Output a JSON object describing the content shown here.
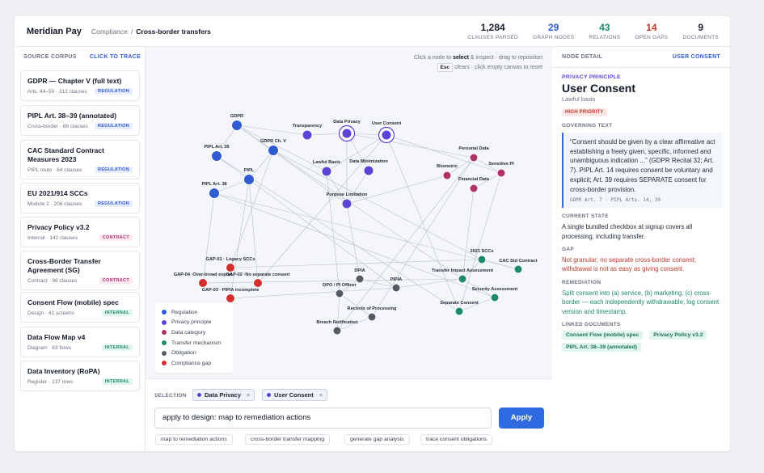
{
  "header": {
    "brand": "Meridian Pay",
    "breadcrumb_root": "Compliance",
    "breadcrumb_sep": "/",
    "breadcrumb_current": "Cross-border transfers",
    "stats": [
      {
        "value": "1,284",
        "label": "CLAUSES PARSED",
        "color": "#111827"
      },
      {
        "value": "29",
        "label": "GRAPH NODES",
        "color": "#2f5bd3"
      },
      {
        "value": "43",
        "label": "RELATIONS",
        "color": "#1d8a6a"
      },
      {
        "value": "14",
        "label": "OPEN GAPS",
        "color": "#c0392b"
      },
      {
        "value": "9",
        "label": "DOCUMENTS",
        "color": "#111827"
      }
    ]
  },
  "source_corpus": {
    "heading": "SOURCE CORPUS",
    "action": "CLICK TO TRACE",
    "items": [
      {
        "title": "GDPR — Chapter V (full text)",
        "meta": "Arts. 44–50 · 312 clauses",
        "tag": "REGULATION",
        "kind": "regulation"
      },
      {
        "title": "PIPL Art. 38–39 (annotated)",
        "meta": "Cross-border · 88 clauses",
        "tag": "REGULATION",
        "kind": "regulation"
      },
      {
        "title": "CAC Standard Contract Measures 2023",
        "meta": "PIPL route · 64 clauses",
        "tag": "REGULATION",
        "kind": "regulation"
      },
      {
        "title": "EU 2021/914 SCCs",
        "meta": "Module 2 · 206 clauses",
        "tag": "REGULATION",
        "kind": "regulation"
      },
      {
        "title": "Privacy Policy v3.2",
        "meta": "Internal · 142 clauses",
        "tag": "CONTRACT",
        "kind": "contract"
      },
      {
        "title": "Cross-Border Transfer Agreement (SG)",
        "meta": "Contract · 98 clauses",
        "tag": "CONTRACT",
        "kind": "contract"
      },
      {
        "title": "Consent Flow (mobile) spec",
        "meta": "Design · 41 screens",
        "tag": "INTERNAL",
        "kind": "internal"
      },
      {
        "title": "Data Flow Map v4",
        "meta": "Diagram · 63 flows",
        "tag": "INTERNAL",
        "kind": "internal"
      },
      {
        "title": "Data Inventory (RoPA)",
        "meta": "Register · 137 rows",
        "tag": "INTERNAL",
        "kind": "internal"
      }
    ]
  },
  "graph": {
    "hint_line1_a": "Click a node to ",
    "hint_line1_b": "select",
    "hint_line1_c": " & inspect · drag to reposition",
    "hint_key": "Esc",
    "hint_line2": " clears · click empty canvas to reset",
    "colors": {
      "regulation": "#2f5bd3",
      "principle": "#5b44d6",
      "category": "#b0306a",
      "transfer": "#1d8a6a",
      "obligation": "#555b63",
      "gap": "#d32f2f"
    },
    "nodes": [
      {
        "id": "gdpr",
        "label": "GDPR",
        "type": "regulation"
      },
      {
        "id": "gdprv",
        "label": "GDPR Ch. V",
        "type": "regulation"
      },
      {
        "id": "pipl39",
        "label": "PIPL Art. 39",
        "type": "regulation"
      },
      {
        "id": "pipl",
        "label": "PIPL",
        "type": "regulation"
      },
      {
        "id": "pipl38",
        "label": "PIPL Art. 38",
        "type": "regulation"
      },
      {
        "id": "transparency",
        "label": "Transparency",
        "type": "principle"
      },
      {
        "id": "dataprivacy",
        "label": "Data Privacy",
        "type": "principle"
      },
      {
        "id": "userconsent",
        "label": "User Consent",
        "type": "principle"
      },
      {
        "id": "lawfulbasis",
        "label": "Lawful Basis",
        "type": "principle"
      },
      {
        "id": "dataminim",
        "label": "Data Minimization",
        "type": "principle"
      },
      {
        "id": "purpose",
        "label": "Purpose Limitation",
        "type": "principle"
      },
      {
        "id": "personal",
        "label": "Personal Data",
        "type": "category"
      },
      {
        "id": "biometric",
        "label": "Biometric",
        "type": "category"
      },
      {
        "id": "sensitive",
        "label": "Sensitive PI",
        "type": "category"
      },
      {
        "id": "financial",
        "label": "Financial Data",
        "type": "category"
      },
      {
        "id": "sccs",
        "label": "2021 SCCs",
        "type": "transfer"
      },
      {
        "id": "cacstd",
        "label": "CAC Std Contract",
        "type": "transfer"
      },
      {
        "id": "tia",
        "label": "Transfer Impact Assessment",
        "type": "transfer"
      },
      {
        "id": "secassess",
        "label": "Security Assessment",
        "type": "transfer"
      },
      {
        "id": "sepconsent",
        "label": "Separate Consent",
        "type": "transfer"
      },
      {
        "id": "dpia",
        "label": "DPIA",
        "type": "obligation"
      },
      {
        "id": "pipia",
        "label": "PIPIA",
        "type": "obligation"
      },
      {
        "id": "dpo",
        "label": "DPO / PI Officer",
        "type": "obligation"
      },
      {
        "id": "records",
        "label": "Records of Processing",
        "type": "obligation"
      },
      {
        "id": "breach",
        "label": "Breach Notification",
        "type": "obligation"
      },
      {
        "id": "gap01",
        "label": "GAP-01 · Legacy SCCs",
        "type": "gap"
      },
      {
        "id": "gap04",
        "label": "GAP-04 ·Over-broad export",
        "type": "gap"
      },
      {
        "id": "gap02",
        "label": "GAP-02 ·No separate consent",
        "type": "gap"
      },
      {
        "id": "gap03",
        "label": "GAP-03 · PIPIA incomplete",
        "type": "gap"
      }
    ],
    "selected": [
      "dataprivacy",
      "userconsent"
    ],
    "legend": [
      {
        "label": "Regulation",
        "type": "regulation"
      },
      {
        "label": "Privacy principle",
        "type": "principle"
      },
      {
        "label": "Data category",
        "type": "category"
      },
      {
        "label": "Transfer mechanism",
        "type": "transfer"
      },
      {
        "label": "Obligation",
        "type": "obligation"
      },
      {
        "label": "Compliance gap",
        "type": "gap"
      }
    ]
  },
  "selection": {
    "label": "SELECTION",
    "chips": [
      "Data Privacy",
      "User Consent"
    ],
    "remove_glyph": "×",
    "command_value": "apply to design: map to remediation actions",
    "apply_label": "Apply",
    "suggestions": [
      "map to remediation actions",
      "cross-border transfer mapping",
      "generate gap analysis",
      "trace consent obligations"
    ]
  },
  "detail": {
    "heading": "NODE DETAIL",
    "current": "USER CONSENT",
    "kicker": "PRIVACY PRINCIPLE",
    "title": "User Consent",
    "subtitle": "Lawful basis",
    "priority": "HIGH PRIORITY",
    "governing_label": "GOVERNING TEXT",
    "governing_text": "“Consent should be given by a clear affirmative act establishing a freely given, specific, informed and unambiguous indication ...” (GDPR Recital 32; Art. 7). PIPL Art. 14 requires consent be voluntary and explicit; Art. 39 requires SEPARATE consent for cross-border provision.",
    "governing_ref": "GDPR Art. 7 · PIPL Arts. 14, 39",
    "state_label": "CURRENT STATE",
    "state_text": "A single bundled checkbox at signup covers all processing, including transfer.",
    "gap_label": "GAP",
    "gap_text": "Not granular; no separate cross-border consent; withdrawal is not as easy as giving consent.",
    "remediation_label": "REMEDIATION",
    "remediation_text": "Split consent into (a) service, (b) marketing, (c) cross-border — each independently withdrawable; log consent version and timestamp.",
    "linked_label": "LINKED DOCUMENTS",
    "linked": [
      "Consent Flow (mobile) spec",
      "Privacy Policy v3.2",
      "PIPL Art. 38–39 (annotated)"
    ]
  }
}
